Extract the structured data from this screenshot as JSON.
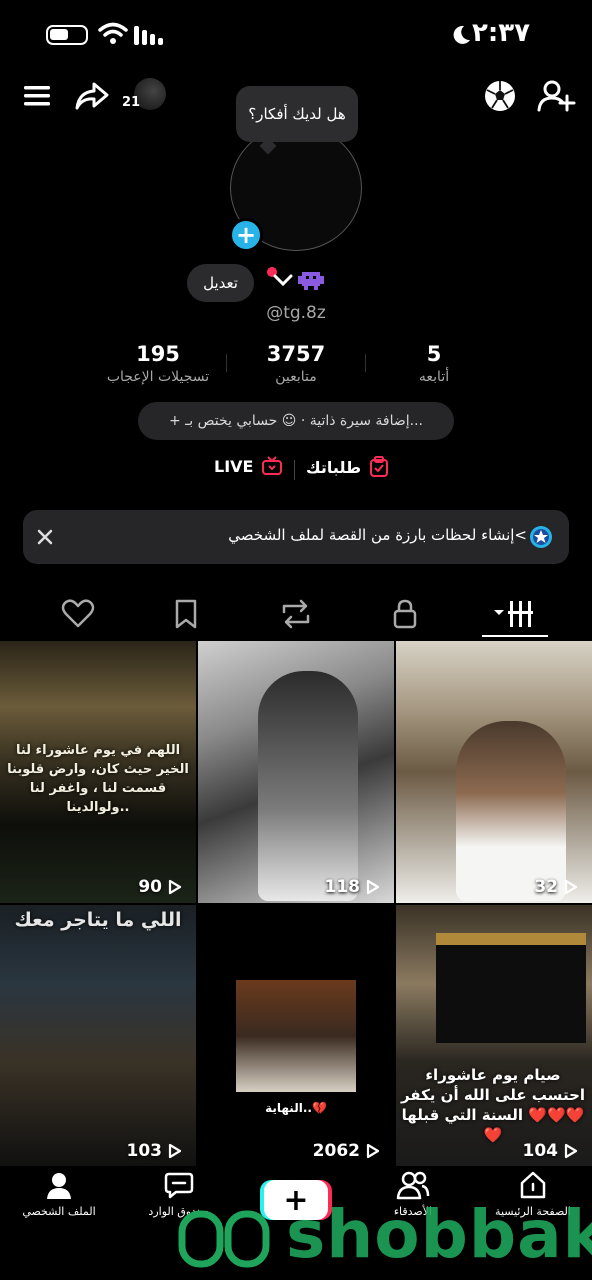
{
  "status_bar": {
    "time": "٢:٣٧"
  },
  "top_bar": {
    "friend_count": "21"
  },
  "profile": {
    "bubble": "هل لديك أفكار؟",
    "edit_label": "تعديل",
    "username": "@tg.8z",
    "stats": [
      {
        "value": "195",
        "label": "تسجيلات الإعجاب"
      },
      {
        "value": "3757",
        "label": "متابعين"
      },
      {
        "value": "5",
        "label": "أتابعه"
      }
    ],
    "bio_pill": "+ إضافة سيرة ذاتية · ☺ حسابي يختص بـ...",
    "orders_label": "طلباتك",
    "live_label": "LIVE",
    "banner_text": "إنشاء لحظات بارزة من القصة لملف الشخصي<"
  },
  "videos": [
    {
      "views": "90",
      "caption": "اللهم في يوم عاشوراء لنا الخير حيث كان، وارض قلوبنا قسمت لنا ، واغفر لنا ولوالدينا.."
    },
    {
      "views": "118",
      "caption": ""
    },
    {
      "views": "32",
      "caption": ""
    },
    {
      "views": "103",
      "caption": "اللي ما يتاجر معك"
    },
    {
      "views": "2062",
      "caption": "النهاية..💔"
    },
    {
      "views": "104",
      "caption": "صيام يوم عاشوراء احتسب على الله أن يكفر السنة التي قبلها ❤️❤️❤️❤️"
    }
  ],
  "bottom_nav": {
    "profile": "الملف الشخصي",
    "inbox": "صندوق الوارد",
    "friends": "الأصدقاء",
    "home": "الصفحة الرئيسية"
  },
  "watermark": "shobbak",
  "colors": {
    "accent_blue": "#27b3e8",
    "accent_red": "#fe2c55",
    "accent_cyan": "#25f4ee",
    "watermark_green": "#1fa55b"
  }
}
